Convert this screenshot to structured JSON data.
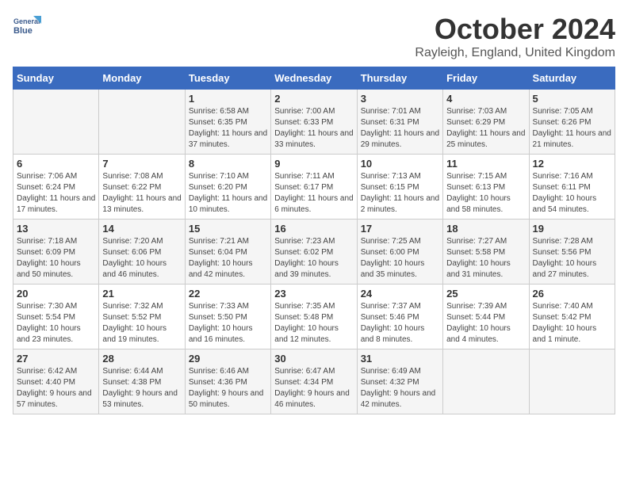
{
  "logo": {
    "line1": "General",
    "line2": "Blue"
  },
  "title": "October 2024",
  "location": "Rayleigh, England, United Kingdom",
  "days_header": [
    "Sunday",
    "Monday",
    "Tuesday",
    "Wednesday",
    "Thursday",
    "Friday",
    "Saturday"
  ],
  "weeks": [
    [
      {
        "day": "",
        "info": ""
      },
      {
        "day": "",
        "info": ""
      },
      {
        "day": "1",
        "info": "Sunrise: 6:58 AM\nSunset: 6:35 PM\nDaylight: 11 hours and 37 minutes."
      },
      {
        "day": "2",
        "info": "Sunrise: 7:00 AM\nSunset: 6:33 PM\nDaylight: 11 hours and 33 minutes."
      },
      {
        "day": "3",
        "info": "Sunrise: 7:01 AM\nSunset: 6:31 PM\nDaylight: 11 hours and 29 minutes."
      },
      {
        "day": "4",
        "info": "Sunrise: 7:03 AM\nSunset: 6:29 PM\nDaylight: 11 hours and 25 minutes."
      },
      {
        "day": "5",
        "info": "Sunrise: 7:05 AM\nSunset: 6:26 PM\nDaylight: 11 hours and 21 minutes."
      }
    ],
    [
      {
        "day": "6",
        "info": "Sunrise: 7:06 AM\nSunset: 6:24 PM\nDaylight: 11 hours and 17 minutes."
      },
      {
        "day": "7",
        "info": "Sunrise: 7:08 AM\nSunset: 6:22 PM\nDaylight: 11 hours and 13 minutes."
      },
      {
        "day": "8",
        "info": "Sunrise: 7:10 AM\nSunset: 6:20 PM\nDaylight: 11 hours and 10 minutes."
      },
      {
        "day": "9",
        "info": "Sunrise: 7:11 AM\nSunset: 6:17 PM\nDaylight: 11 hours and 6 minutes."
      },
      {
        "day": "10",
        "info": "Sunrise: 7:13 AM\nSunset: 6:15 PM\nDaylight: 11 hours and 2 minutes."
      },
      {
        "day": "11",
        "info": "Sunrise: 7:15 AM\nSunset: 6:13 PM\nDaylight: 10 hours and 58 minutes."
      },
      {
        "day": "12",
        "info": "Sunrise: 7:16 AM\nSunset: 6:11 PM\nDaylight: 10 hours and 54 minutes."
      }
    ],
    [
      {
        "day": "13",
        "info": "Sunrise: 7:18 AM\nSunset: 6:09 PM\nDaylight: 10 hours and 50 minutes."
      },
      {
        "day": "14",
        "info": "Sunrise: 7:20 AM\nSunset: 6:06 PM\nDaylight: 10 hours and 46 minutes."
      },
      {
        "day": "15",
        "info": "Sunrise: 7:21 AM\nSunset: 6:04 PM\nDaylight: 10 hours and 42 minutes."
      },
      {
        "day": "16",
        "info": "Sunrise: 7:23 AM\nSunset: 6:02 PM\nDaylight: 10 hours and 39 minutes."
      },
      {
        "day": "17",
        "info": "Sunrise: 7:25 AM\nSunset: 6:00 PM\nDaylight: 10 hours and 35 minutes."
      },
      {
        "day": "18",
        "info": "Sunrise: 7:27 AM\nSunset: 5:58 PM\nDaylight: 10 hours and 31 minutes."
      },
      {
        "day": "19",
        "info": "Sunrise: 7:28 AM\nSunset: 5:56 PM\nDaylight: 10 hours and 27 minutes."
      }
    ],
    [
      {
        "day": "20",
        "info": "Sunrise: 7:30 AM\nSunset: 5:54 PM\nDaylight: 10 hours and 23 minutes."
      },
      {
        "day": "21",
        "info": "Sunrise: 7:32 AM\nSunset: 5:52 PM\nDaylight: 10 hours and 19 minutes."
      },
      {
        "day": "22",
        "info": "Sunrise: 7:33 AM\nSunset: 5:50 PM\nDaylight: 10 hours and 16 minutes."
      },
      {
        "day": "23",
        "info": "Sunrise: 7:35 AM\nSunset: 5:48 PM\nDaylight: 10 hours and 12 minutes."
      },
      {
        "day": "24",
        "info": "Sunrise: 7:37 AM\nSunset: 5:46 PM\nDaylight: 10 hours and 8 minutes."
      },
      {
        "day": "25",
        "info": "Sunrise: 7:39 AM\nSunset: 5:44 PM\nDaylight: 10 hours and 4 minutes."
      },
      {
        "day": "26",
        "info": "Sunrise: 7:40 AM\nSunset: 5:42 PM\nDaylight: 10 hours and 1 minute."
      }
    ],
    [
      {
        "day": "27",
        "info": "Sunrise: 6:42 AM\nSunset: 4:40 PM\nDaylight: 9 hours and 57 minutes."
      },
      {
        "day": "28",
        "info": "Sunrise: 6:44 AM\nSunset: 4:38 PM\nDaylight: 9 hours and 53 minutes."
      },
      {
        "day": "29",
        "info": "Sunrise: 6:46 AM\nSunset: 4:36 PM\nDaylight: 9 hours and 50 minutes."
      },
      {
        "day": "30",
        "info": "Sunrise: 6:47 AM\nSunset: 4:34 PM\nDaylight: 9 hours and 46 minutes."
      },
      {
        "day": "31",
        "info": "Sunrise: 6:49 AM\nSunset: 4:32 PM\nDaylight: 9 hours and 42 minutes."
      },
      {
        "day": "",
        "info": ""
      },
      {
        "day": "",
        "info": ""
      }
    ]
  ]
}
